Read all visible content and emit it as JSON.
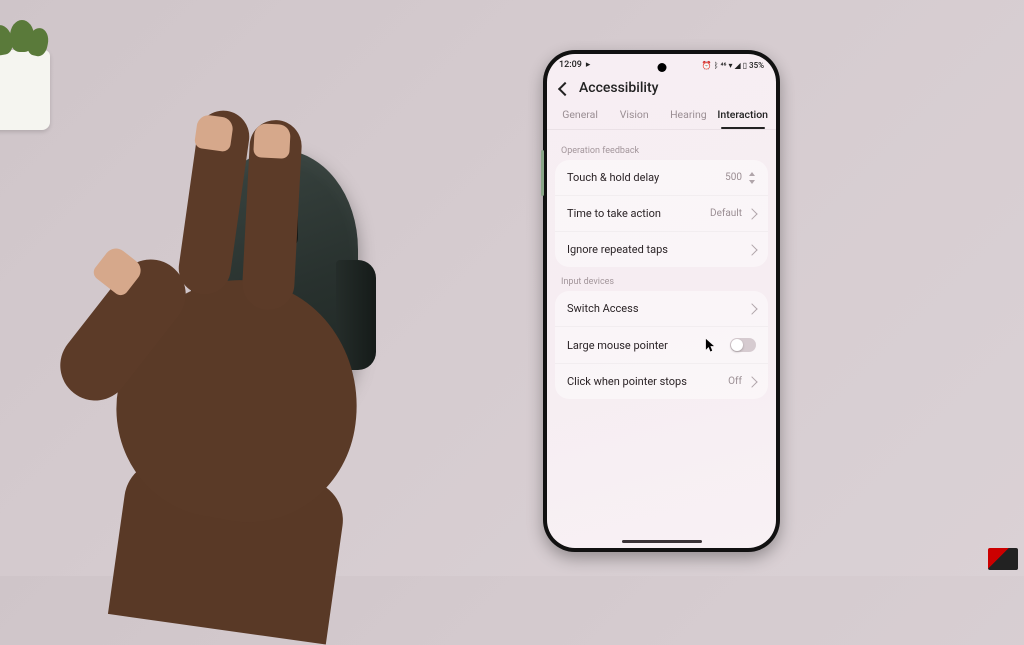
{
  "status_bar": {
    "time": "12:09",
    "battery_text": "35%"
  },
  "header": {
    "title": "Accessibility"
  },
  "tabs": {
    "general": "General",
    "vision": "Vision",
    "hearing": "Hearing",
    "interaction": "Interaction"
  },
  "sections": {
    "operation_feedback": {
      "label": "Operation feedback",
      "items": {
        "touch_hold": {
          "label": "Touch & hold delay",
          "value": "500"
        },
        "time_to_act": {
          "label": "Time to take action",
          "value": "Default"
        },
        "ignore_taps": {
          "label": "Ignore repeated taps"
        }
      }
    },
    "input_devices": {
      "label": "Input devices",
      "items": {
        "switch_access": {
          "label": "Switch Access"
        },
        "large_pointer": {
          "label": "Large mouse pointer",
          "state": "off"
        },
        "click_stops": {
          "label": "Click when pointer stops",
          "value": "Off"
        }
      }
    }
  }
}
